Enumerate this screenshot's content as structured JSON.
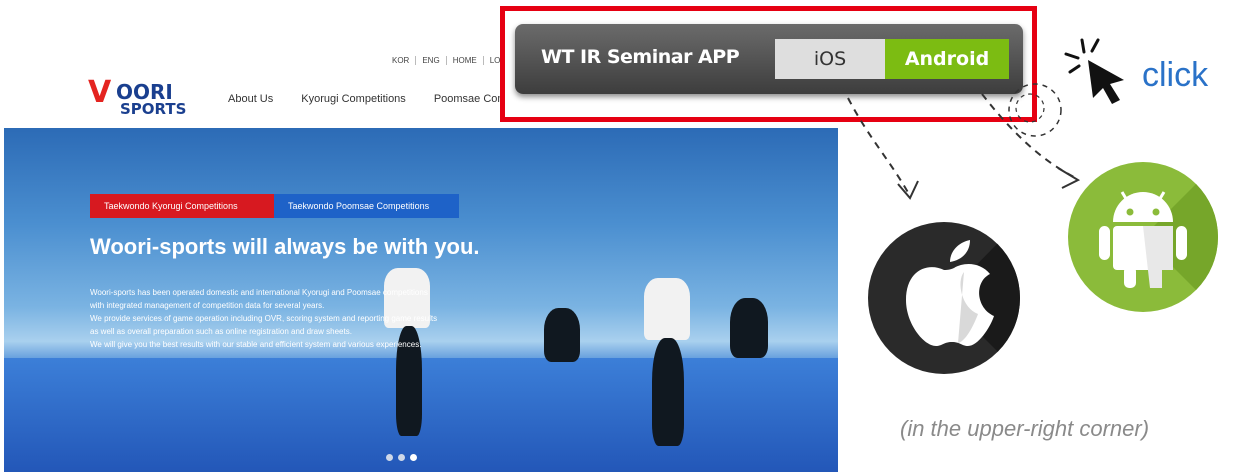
{
  "header": {
    "logo_text": "WOORI SPORTS",
    "top_links": [
      "KOR",
      "ENG",
      "HOME",
      "LOGI"
    ],
    "nav": [
      "About Us",
      "Kyorugi Competitions",
      "Poomsae Compe"
    ]
  },
  "hero": {
    "tabs": [
      "Taekwondo Kyorugi Competitions",
      "Taekwondo Poomsae Competitions"
    ],
    "title": "Woori-sports will always be with you.",
    "description": [
      "Woori-sports has been operated domestic and international Kyorugi and Poomsae competitions",
      "with integrated management of competition data for several years.",
      "We provide services of game operation including OVR, scoring system and reporting game results",
      "as well as overall preparation such as online registration and draw sheets.",
      "We will give you the best results with our stable and efficient system and various experiences."
    ],
    "slide_count": 3,
    "active_slide": 3
  },
  "app_bar": {
    "title": "WT IR Seminar APP",
    "ios_label": "iOS",
    "android_label": "Android"
  },
  "annotation": {
    "click_label": "click",
    "note": "(in the upper-right corner)"
  },
  "icons": [
    "cursor-icon",
    "apple-icon",
    "android-icon"
  ],
  "colors": {
    "frame": "#e60012",
    "android_green": "#7cbc12",
    "click_blue": "#2a72c8",
    "kyorugi_tab": "#d71920",
    "poomsae_tab": "#1e62c8"
  }
}
